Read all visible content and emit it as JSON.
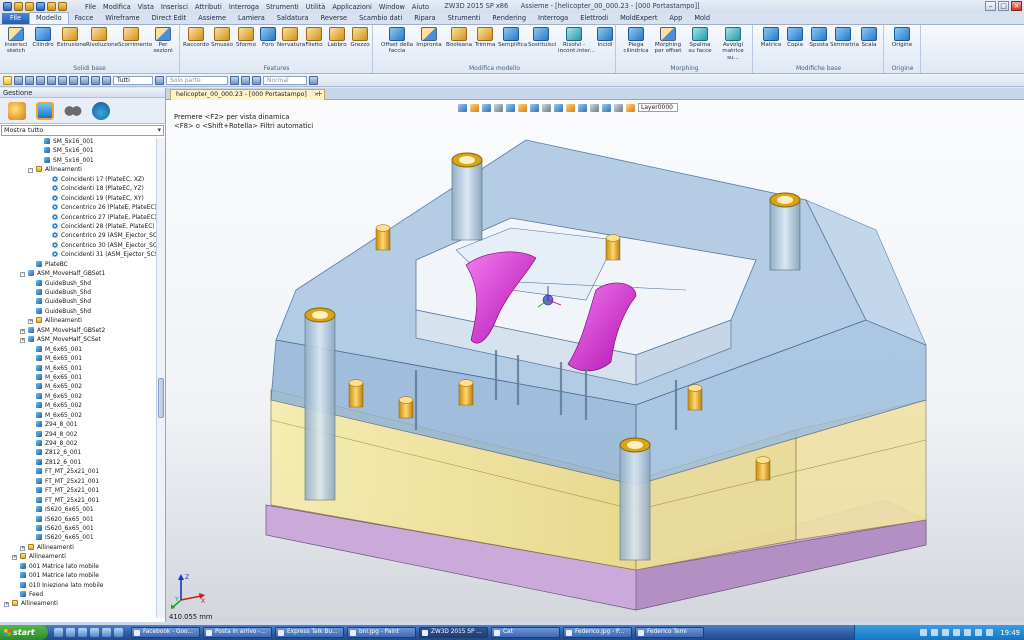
{
  "titlebar": {
    "menus": [
      "File",
      "Modifica",
      "Vista",
      "Inserisci",
      "Attributi",
      "Interroga",
      "Strumenti",
      "Utilità",
      "Applicazioni",
      "Window",
      "Aiuto"
    ],
    "app_title": "ZW3D 2015 SP x86",
    "doc_title": "Assieme - [helicopter_00_000.23 - [000 Portastampo]]"
  },
  "tabs": [
    "File",
    "Modello",
    "Facce",
    "Wireframe",
    "Direct Edit",
    "Assieme",
    "Lamiera",
    "Saldatura",
    "Reverse",
    "Scambio dati",
    "Ripara",
    "Strumenti",
    "Rendering",
    "Interroga",
    "Elettrodi",
    "MoldExpert",
    "App",
    "Mold"
  ],
  "ribbon": {
    "groups": [
      {
        "name": "Solidi base",
        "buttons": [
          "Inserisci sketch",
          "Cilindro",
          "Estrusione",
          "Rivoluzione",
          "Scorrimento",
          "Per sezioni"
        ]
      },
      {
        "name": "Features",
        "buttons": [
          "Raccordo",
          "Smusso",
          "Sformo",
          "Foro",
          "Nervatura",
          "Filetto",
          "Labbro",
          "Grezzo"
        ]
      },
      {
        "name": "Modifica modello",
        "buttons": [
          "Offset della faccia",
          "Impronta",
          "Booleana",
          "Trimma",
          "Semplifica",
          "Sostituisci",
          "Risolvi - incont.inter...",
          "Incidi"
        ]
      },
      {
        "name": "Morphing",
        "buttons": [
          "Piega cilindrica",
          "Morphing per offset",
          "Spalma su facce",
          "Avvolgi matrice su..."
        ]
      },
      {
        "name": "Modifiche base",
        "buttons": [
          "Matrice",
          "Copia",
          "Sposta",
          "Simmetria",
          "Scala"
        ]
      },
      {
        "name": "Origine",
        "buttons": [
          "Origine"
        ]
      }
    ]
  },
  "toolrow": {
    "filter": "Tutti",
    "part": "Solo parte",
    "mode": "Normal"
  },
  "leftpanel": {
    "title": "Gestione",
    "filter": "Mostra tutto",
    "tree": [
      {
        "label": "SM_5x16_001",
        "icon": "part",
        "level": 4
      },
      {
        "label": "SM_5x16_001",
        "icon": "part",
        "level": 4
      },
      {
        "label": "SM_5x16_001",
        "icon": "part",
        "level": 4
      },
      {
        "label": "Allineamenti",
        "icon": "folder",
        "level": 3,
        "expand": "-"
      },
      {
        "label": "Coincidenti 17 (PlateEC, XZ)",
        "icon": "constraint",
        "level": 5
      },
      {
        "label": "Coincidenti 18 (PlateEC, YZ)",
        "icon": "constraint",
        "level": 5
      },
      {
        "label": "Coincidenti 19 (PlateEC, XY)",
        "icon": "constraint",
        "level": 5
      },
      {
        "label": "Concentrico 26 (PlateE, PlateEC)",
        "icon": "constraint",
        "level": 5
      },
      {
        "label": "Concentrico 27 (PlateE, PlateEC)",
        "icon": "constraint",
        "level": 5
      },
      {
        "label": "Coincidenti 28 (PlateE, PlateEC)",
        "icon": "constraint",
        "level": 5
      },
      {
        "label": "Concentrico 29 (ASM_Ejector_SCSet",
        "icon": "constraint",
        "level": 5
      },
      {
        "label": "Concentrico 30 (ASM_Ejector_SCSet",
        "icon": "constraint",
        "level": 5
      },
      {
        "label": "Coincidenti 31 (ASM_Ejector_SCSet,",
        "icon": "constraint",
        "level": 5
      },
      {
        "label": "PlateBC",
        "icon": "part",
        "level": 3
      },
      {
        "label": "ASM_MoveHalf_GBSet1",
        "icon": "asm",
        "level": 2,
        "expand": "-"
      },
      {
        "label": "GuideBush_Shd",
        "icon": "part",
        "level": 3
      },
      {
        "label": "GuideBush_Shd",
        "icon": "part",
        "level": 3
      },
      {
        "label": "GuideBush_Shd",
        "icon": "part",
        "level": 3
      },
      {
        "label": "GuideBush_Shd",
        "icon": "part",
        "level": 3
      },
      {
        "label": "Allineamenti",
        "icon": "folder",
        "level": 3,
        "expand": "+"
      },
      {
        "label": "ASM_MoveHalf_GBSet2",
        "icon": "asm",
        "level": 2,
        "expand": "+"
      },
      {
        "label": "ASM_MoveHalf_SCSet",
        "icon": "asm",
        "level": 2,
        "expand": "+"
      },
      {
        "label": "M_6x65_001",
        "icon": "part",
        "level": 3
      },
      {
        "label": "M_6x65_001",
        "icon": "part",
        "level": 3
      },
      {
        "label": "M_6x65_001",
        "icon": "part",
        "level": 3
      },
      {
        "label": "M_6x65_001",
        "icon": "part",
        "level": 3
      },
      {
        "label": "M_6x65_002",
        "icon": "part",
        "level": 3
      },
      {
        "label": "M_6x65_002",
        "icon": "part",
        "level": 3
      },
      {
        "label": "M_6x65_002",
        "icon": "part",
        "level": 3
      },
      {
        "label": "M_6x65_002",
        "icon": "part",
        "level": 3
      },
      {
        "label": "Z94_8_001",
        "icon": "part",
        "level": 3
      },
      {
        "label": "Z94_8_002",
        "icon": "part",
        "level": 3
      },
      {
        "label": "Z94_8_002",
        "icon": "part",
        "level": 3
      },
      {
        "label": "Z812_6_001",
        "icon": "part",
        "level": 3
      },
      {
        "label": "Z812_6_001",
        "icon": "part",
        "level": 3
      },
      {
        "label": "FT_MT_25x21_001",
        "icon": "part",
        "level": 3
      },
      {
        "label": "FT_MT_25x21_001",
        "icon": "part",
        "level": 3
      },
      {
        "label": "FT_MT_25x21_001",
        "icon": "part",
        "level": 3
      },
      {
        "label": "FT_MT_25x21_001",
        "icon": "part",
        "level": 3
      },
      {
        "label": "IS620_6x65_001",
        "icon": "part",
        "level": 3
      },
      {
        "label": "IS620_6x65_001",
        "icon": "part",
        "level": 3
      },
      {
        "label": "IS620_6x65_001",
        "icon": "part",
        "level": 3
      },
      {
        "label": "IS620_6x65_001",
        "icon": "part",
        "level": 3
      },
      {
        "label": "Allineamenti",
        "icon": "folder",
        "level": 2,
        "expand": "+"
      },
      {
        "label": "Allineamenti",
        "icon": "folder",
        "level": 1,
        "expand": "+"
      },
      {
        "label": "001 Matrice lato mobile",
        "icon": "part",
        "level": 1
      },
      {
        "label": "001 Matrice lato mobile",
        "icon": "part",
        "level": 1
      },
      {
        "label": "010 Iniezione lato mobile",
        "icon": "part",
        "level": 1
      },
      {
        "label": "Feed",
        "icon": "part",
        "level": 1
      },
      {
        "label": "Allineamenti",
        "icon": "folder",
        "level": 0,
        "expand": "+"
      }
    ]
  },
  "document": {
    "tab": "helicopter_00_000.23 - [000 Portastampo]",
    "close": "×",
    "add": "+"
  },
  "viewport": {
    "hint_line1": "Premere <F2> per vista dinamica",
    "hint_line2": "<F8> o <Shift+Rotella> Filtri automatici",
    "layer": "Layer0000",
    "scale": "410.055 mm"
  },
  "taskbar": {
    "start": "start",
    "tasks": [
      "Facebook - Goo...",
      "Posta in arrivo -...",
      "Express Talk Bu...",
      "bnl.jpg - Paint",
      "ZW3D 2015 SP ...",
      "Cat",
      "Federico.jpg - P...",
      "Federico Temi"
    ],
    "active_index": 4,
    "clock": "19:49"
  },
  "colors": {
    "plate_blue": "#8fb5d8",
    "plate_yellow": "#f2e6a0",
    "plate_purple": "#c9a6d8",
    "core_white": "#eef3f8",
    "part_magenta": "#e020d8",
    "guide_gold": "#e5a81c"
  }
}
